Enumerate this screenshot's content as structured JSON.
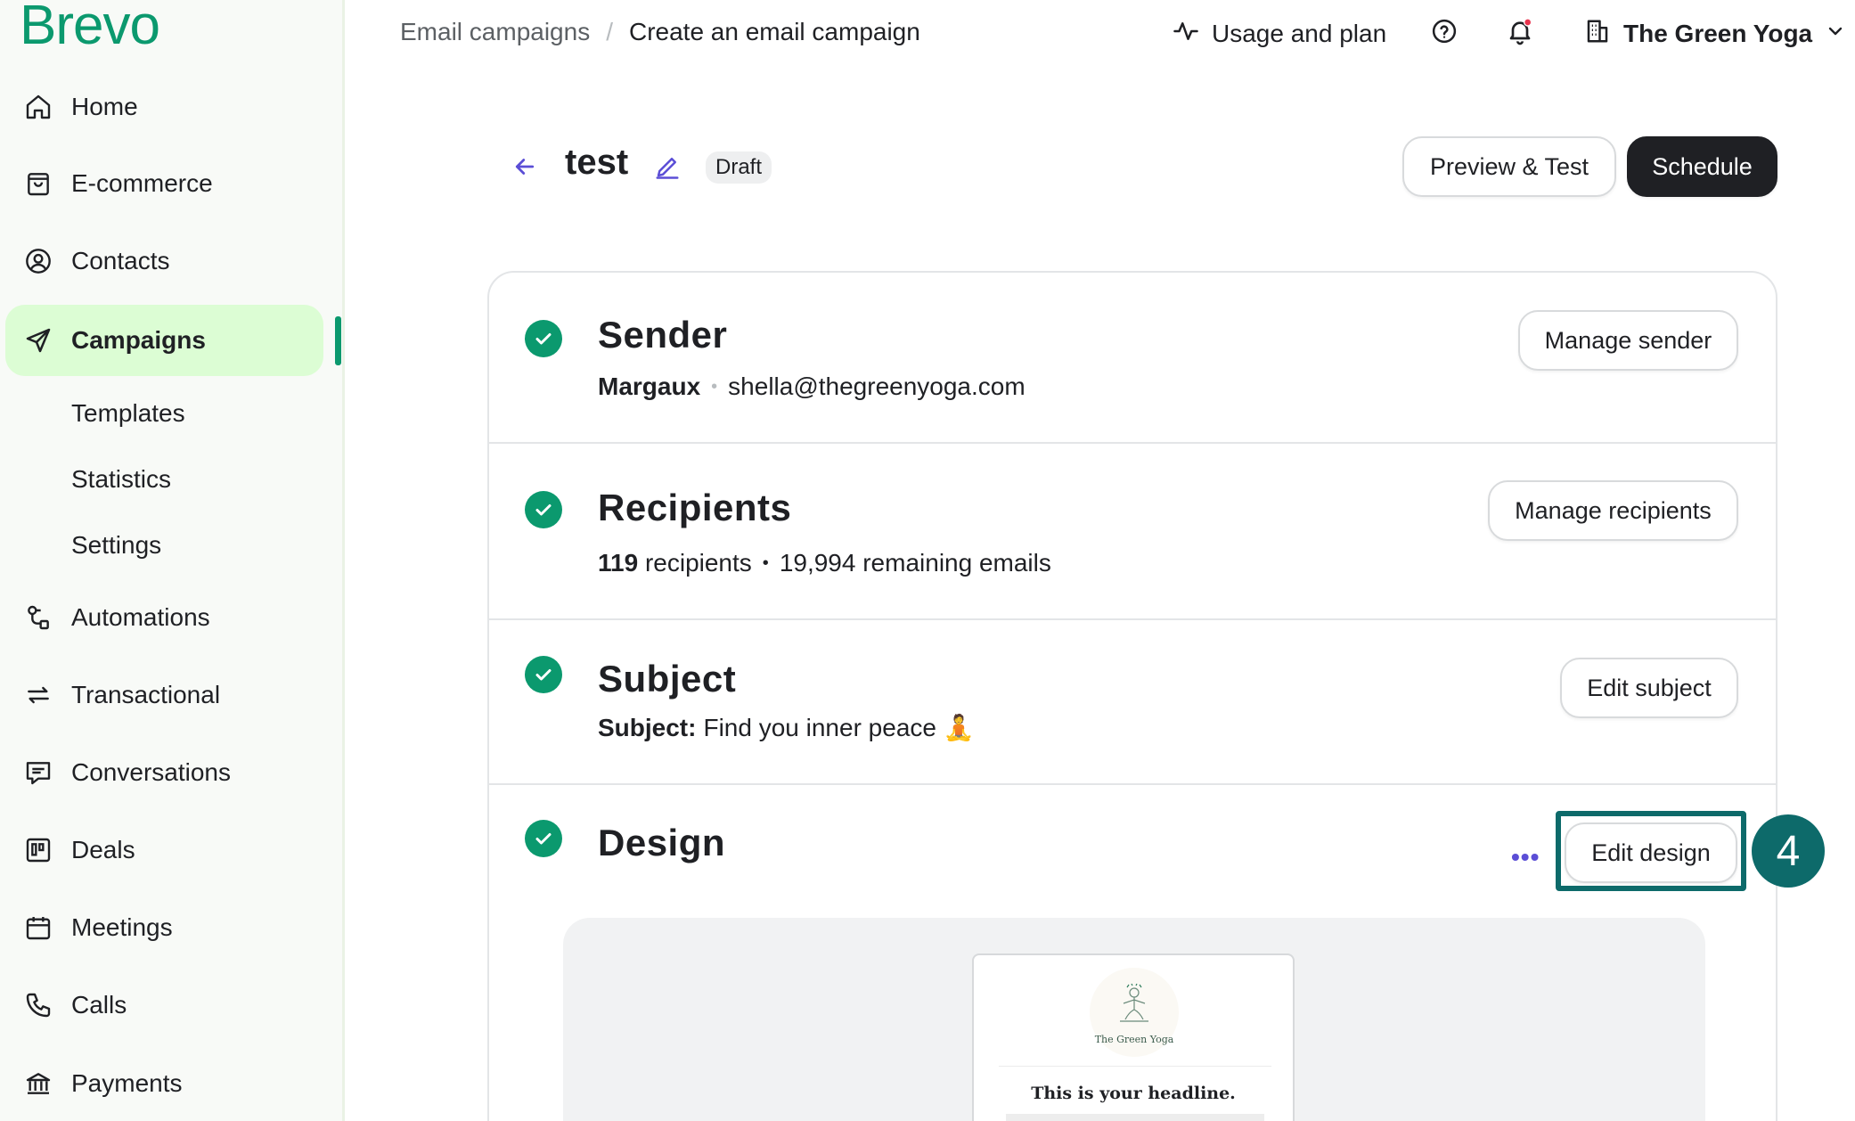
{
  "brand": {
    "logo_text": "Brevo",
    "accent": "#0b996e",
    "active_bg": "#dcfdd4"
  },
  "sidebar": {
    "items": [
      {
        "label": "Home",
        "icon": "home-icon"
      },
      {
        "label": "E-commerce",
        "icon": "shopping-bag-icon"
      },
      {
        "label": "Contacts",
        "icon": "user-circle-icon"
      },
      {
        "label": "Campaigns",
        "icon": "paper-plane-icon",
        "active": true
      },
      {
        "label": "Automations",
        "icon": "automation-icon"
      },
      {
        "label": "Transactional",
        "icon": "arrows-exchange-icon"
      },
      {
        "label": "Conversations",
        "icon": "chat-icon"
      },
      {
        "label": "Deals",
        "icon": "kanban-icon"
      },
      {
        "label": "Meetings",
        "icon": "calendar-icon"
      },
      {
        "label": "Calls",
        "icon": "phone-icon"
      },
      {
        "label": "Payments",
        "icon": "bank-icon"
      }
    ],
    "campaign_subitems": [
      "Templates",
      "Statistics",
      "Settings"
    ]
  },
  "topbar": {
    "breadcrumb": [
      "Email campaigns",
      "Create an email campaign"
    ],
    "usage_label": "Usage and plan",
    "org_name": "The Green Yoga"
  },
  "campaign": {
    "name": "test",
    "status": "Draft",
    "preview_button": "Preview & Test",
    "schedule_button": "Schedule"
  },
  "sections": {
    "sender": {
      "title": "Sender",
      "name": "Margaux",
      "email": "shella@thegreenyoga.com",
      "button": "Manage sender"
    },
    "recipients": {
      "title": "Recipients",
      "count": "119",
      "count_suffix": "recipients",
      "remaining": "19,994 remaining emails",
      "button": "Manage recipients"
    },
    "subject": {
      "title": "Subject",
      "label": "Subject:",
      "value": "Find you inner peace 🧘",
      "button": "Edit subject"
    },
    "design": {
      "title": "Design",
      "button": "Edit design",
      "more": "•••",
      "step_number": "4",
      "thumb_brand": "The Green Yoga",
      "thumb_headline": "This is your headline."
    }
  }
}
